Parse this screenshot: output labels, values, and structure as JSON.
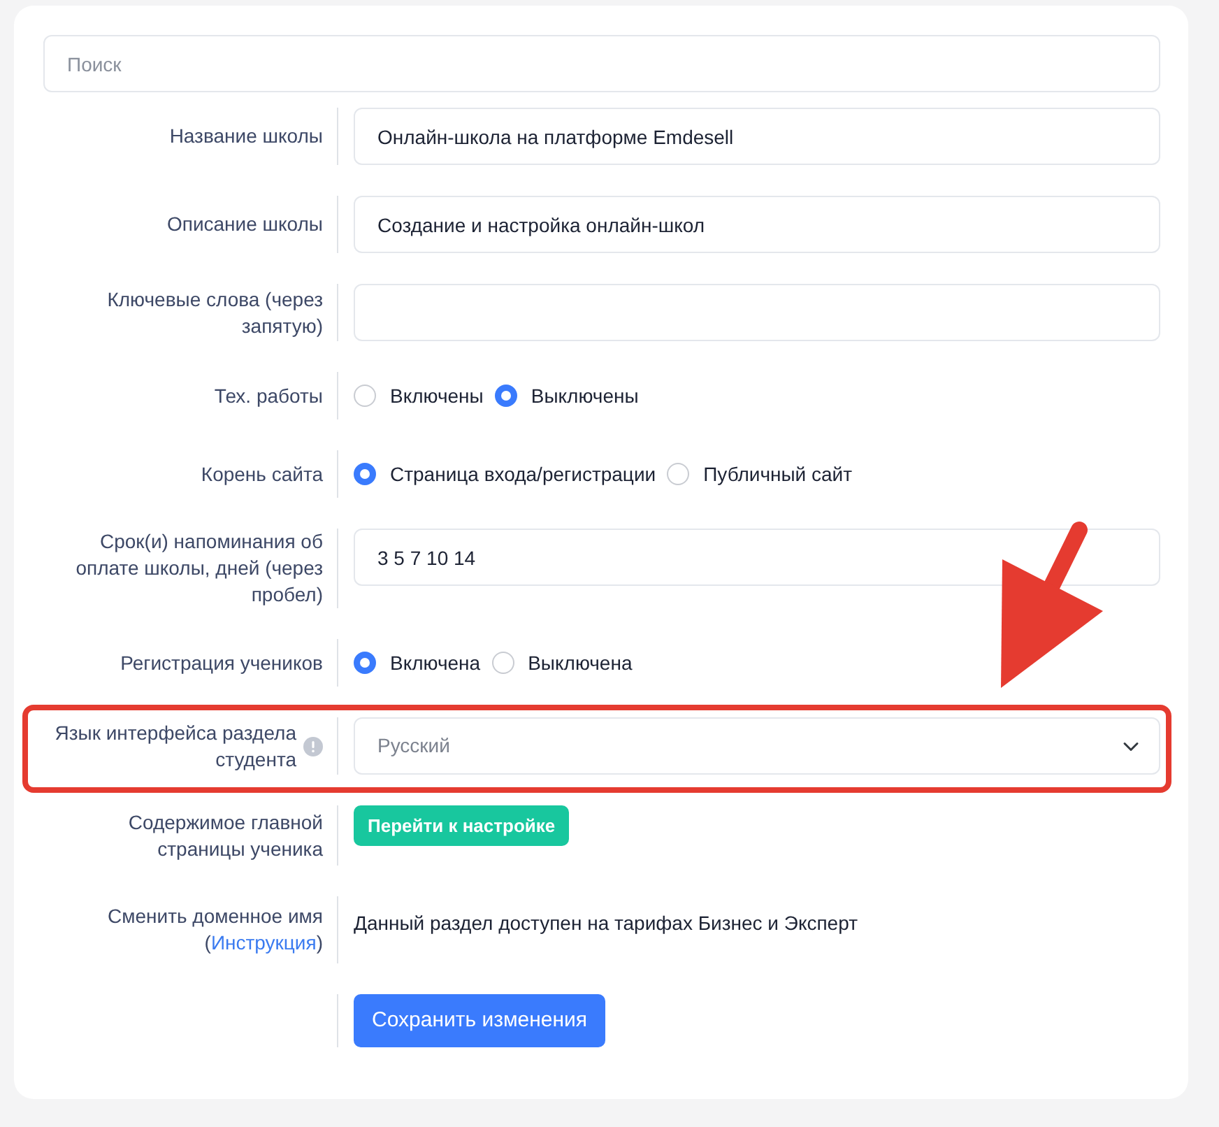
{
  "search": {
    "placeholder": "Поиск"
  },
  "rows": [
    {
      "kind": "text",
      "label": "Название школы",
      "value": "Онлайн-школа на платформе Emdesell"
    },
    {
      "kind": "text",
      "label": "Описание школы",
      "value": "Создание и настройка онлайн-школ"
    },
    {
      "kind": "text",
      "label": "Ключевые слова (через запятую)"
    },
    {
      "kind": "radio",
      "label": "Тех. работы",
      "options": [
        {
          "label": "Включены",
          "selected": false
        },
        {
          "label": "Выключены",
          "selected": true
        }
      ]
    },
    {
      "kind": "radio",
      "label": "Корень сайта",
      "options": [
        {
          "label": "Страница входа/регистрации",
          "selected": true
        },
        {
          "label": "Публичный сайт",
          "selected": false
        }
      ]
    },
    {
      "kind": "text",
      "label": "Срок(и) напоминания об оплате школы, дней (через пробел)",
      "value": "3 5 7 10 14"
    },
    {
      "kind": "radio",
      "label": "Регистрация учеников",
      "options": [
        {
          "label": "Включена",
          "selected": true
        },
        {
          "label": "Выключена",
          "selected": false
        }
      ]
    },
    {
      "kind": "select",
      "label": "Язык интерфейса раздела студента",
      "info": true,
      "highlighted": true,
      "value": "Русский"
    },
    {
      "kind": "button",
      "label": "Содержимое главной страницы ученика",
      "button": "Перейти к настройке"
    },
    {
      "kind": "note",
      "label": "Сменить доменное имя (",
      "link": "Инструкция",
      "label_end": ")",
      "text": "Данный раздел доступен на тарифах Бизнес и Эксперт"
    },
    {
      "kind": "save",
      "button": "Сохранить изменения"
    }
  ]
}
